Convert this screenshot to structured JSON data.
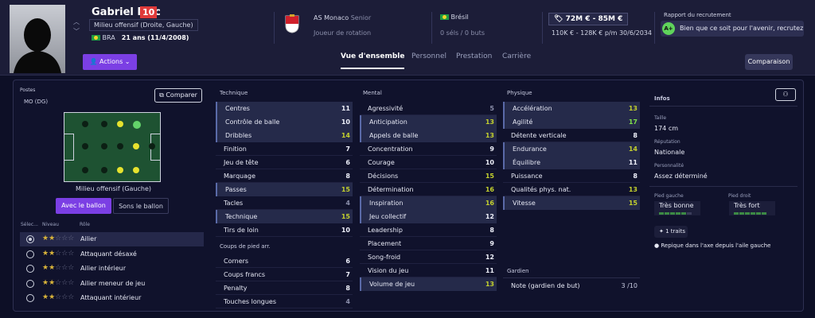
{
  "header": {
    "name": "Gabriel Mec",
    "number": "10",
    "position": "Milieu offensif (Droite, Gauche)",
    "nationality": "BRA",
    "age": "21 ans (11/4/2008)",
    "actions_label": "Actions",
    "club": "AS Monaco",
    "club_level": "Senior",
    "club_role": "Joueur de rotation",
    "nation": "Brésil",
    "caps": "0 séls / 0 buts",
    "value": "72M € - 85M €",
    "wage": "110K € - 128K € p/m",
    "contract": "30/6/2034",
    "report_label": "Rapport du recrutement",
    "report_grade": "A+",
    "report_text": "Bien que ce soit pour l'avenir, recrutez Gabr...",
    "tabs": [
      "Vue d'ensemble",
      "Personnel",
      "Prestation",
      "Carrière"
    ],
    "comparison_label": "Comparaison",
    "icons": {
      "actions": "person-icon",
      "club": "monaco-crest-icon"
    }
  },
  "positions": {
    "title": "Postes",
    "current": "MO (DG)",
    "compare_label": "Comparer",
    "role_label": "Milieu offensif (Gauche)",
    "with_ball": "Avec le ballon",
    "without_ball": "Sons le ballon",
    "col_select": "Sélec...",
    "col_level": "Niveau",
    "col_role": "Rôle",
    "roles": [
      {
        "name": "Ailier",
        "stars": 2,
        "selected": true
      },
      {
        "name": "Attaquant désaxé",
        "stars": 2,
        "selected": false
      },
      {
        "name": "Ailier intérieur",
        "stars": 2,
        "selected": false
      },
      {
        "name": "Ailier meneur de jeu",
        "stars": 2,
        "selected": false
      },
      {
        "name": "Attaquant intérieur",
        "stars": 2,
        "selected": false
      }
    ]
  },
  "technique": {
    "title": "Technique",
    "items": [
      {
        "name": "Centres",
        "value": "11",
        "hl": true
      },
      {
        "name": "Contrôle de balle",
        "value": "10",
        "hl": true
      },
      {
        "name": "Dribbles",
        "value": "14",
        "hl": true
      },
      {
        "name": "Finition",
        "value": "7",
        "hl": false
      },
      {
        "name": "Jeu de tête",
        "value": "6",
        "hl": false
      },
      {
        "name": "Marquage",
        "value": "8",
        "hl": false
      },
      {
        "name": "Passes",
        "value": "15",
        "hl": true
      },
      {
        "name": "Tacles",
        "value": "4",
        "hl": false
      },
      {
        "name": "Technique",
        "value": "15",
        "hl": true
      },
      {
        "name": "Tirs de loin",
        "value": "10",
        "hl": false
      }
    ]
  },
  "set_pieces": {
    "title": "Coups de pied arr.",
    "items": [
      {
        "name": "Corners",
        "value": "6",
        "hl": false
      },
      {
        "name": "Coups francs",
        "value": "7",
        "hl": false
      },
      {
        "name": "Penalty",
        "value": "8",
        "hl": false
      },
      {
        "name": "Touches longues",
        "value": "4",
        "hl": false
      }
    ]
  },
  "mental": {
    "title": "Mental",
    "items": [
      {
        "name": "Agressivité",
        "value": "5",
        "hl": false
      },
      {
        "name": "Anticipation",
        "value": "13",
        "hl": true
      },
      {
        "name": "Appels de balle",
        "value": "13",
        "hl": true
      },
      {
        "name": "Concentration",
        "value": "9",
        "hl": false
      },
      {
        "name": "Courage",
        "value": "10",
        "hl": false
      },
      {
        "name": "Décisions",
        "value": "15",
        "hl": false
      },
      {
        "name": "Détermination",
        "value": "16",
        "hl": false
      },
      {
        "name": "Inspiration",
        "value": "16",
        "hl": true
      },
      {
        "name": "Jeu collectif",
        "value": "12",
        "hl": true
      },
      {
        "name": "Leadership",
        "value": "8",
        "hl": false
      },
      {
        "name": "Placement",
        "value": "9",
        "hl": false
      },
      {
        "name": "Song-froid",
        "value": "12",
        "hl": false
      },
      {
        "name": "Vision du jeu",
        "value": "11",
        "hl": false
      },
      {
        "name": "Volume de jeu",
        "value": "13",
        "hl": true
      }
    ]
  },
  "physical": {
    "title": "Physique",
    "items": [
      {
        "name": "Accélération",
        "value": "13",
        "hl": true
      },
      {
        "name": "Agilité",
        "value": "17",
        "hl": true
      },
      {
        "name": "Détente verticale",
        "value": "8",
        "hl": false
      },
      {
        "name": "Endurance",
        "value": "14",
        "hl": true
      },
      {
        "name": "Équilibre",
        "value": "11",
        "hl": true
      },
      {
        "name": "Puissance",
        "value": "8",
        "hl": false
      },
      {
        "name": "Qualités phys. nat.",
        "value": "13",
        "hl": false
      },
      {
        "name": "Vitesse",
        "value": "15",
        "hl": true
      }
    ]
  },
  "goalkeeper": {
    "title": "Gardien",
    "rating_label": "Note (gardien de but)",
    "rating": "3 /10"
  },
  "info": {
    "title": "Infos",
    "height_label": "Taille",
    "height": "174 cm",
    "reputation_label": "Réputation",
    "reputation": "Nationale",
    "personality_label": "Personnalité",
    "personality": "Assez déterminé",
    "left_foot_label": "Pied gauche",
    "left_foot": "Très bonne",
    "right_foot_label": "Pied droit",
    "right_foot": "Très fort",
    "traits_label": "1 traits",
    "trait": "Repique dans l'axe depuis l'aile gauche"
  }
}
